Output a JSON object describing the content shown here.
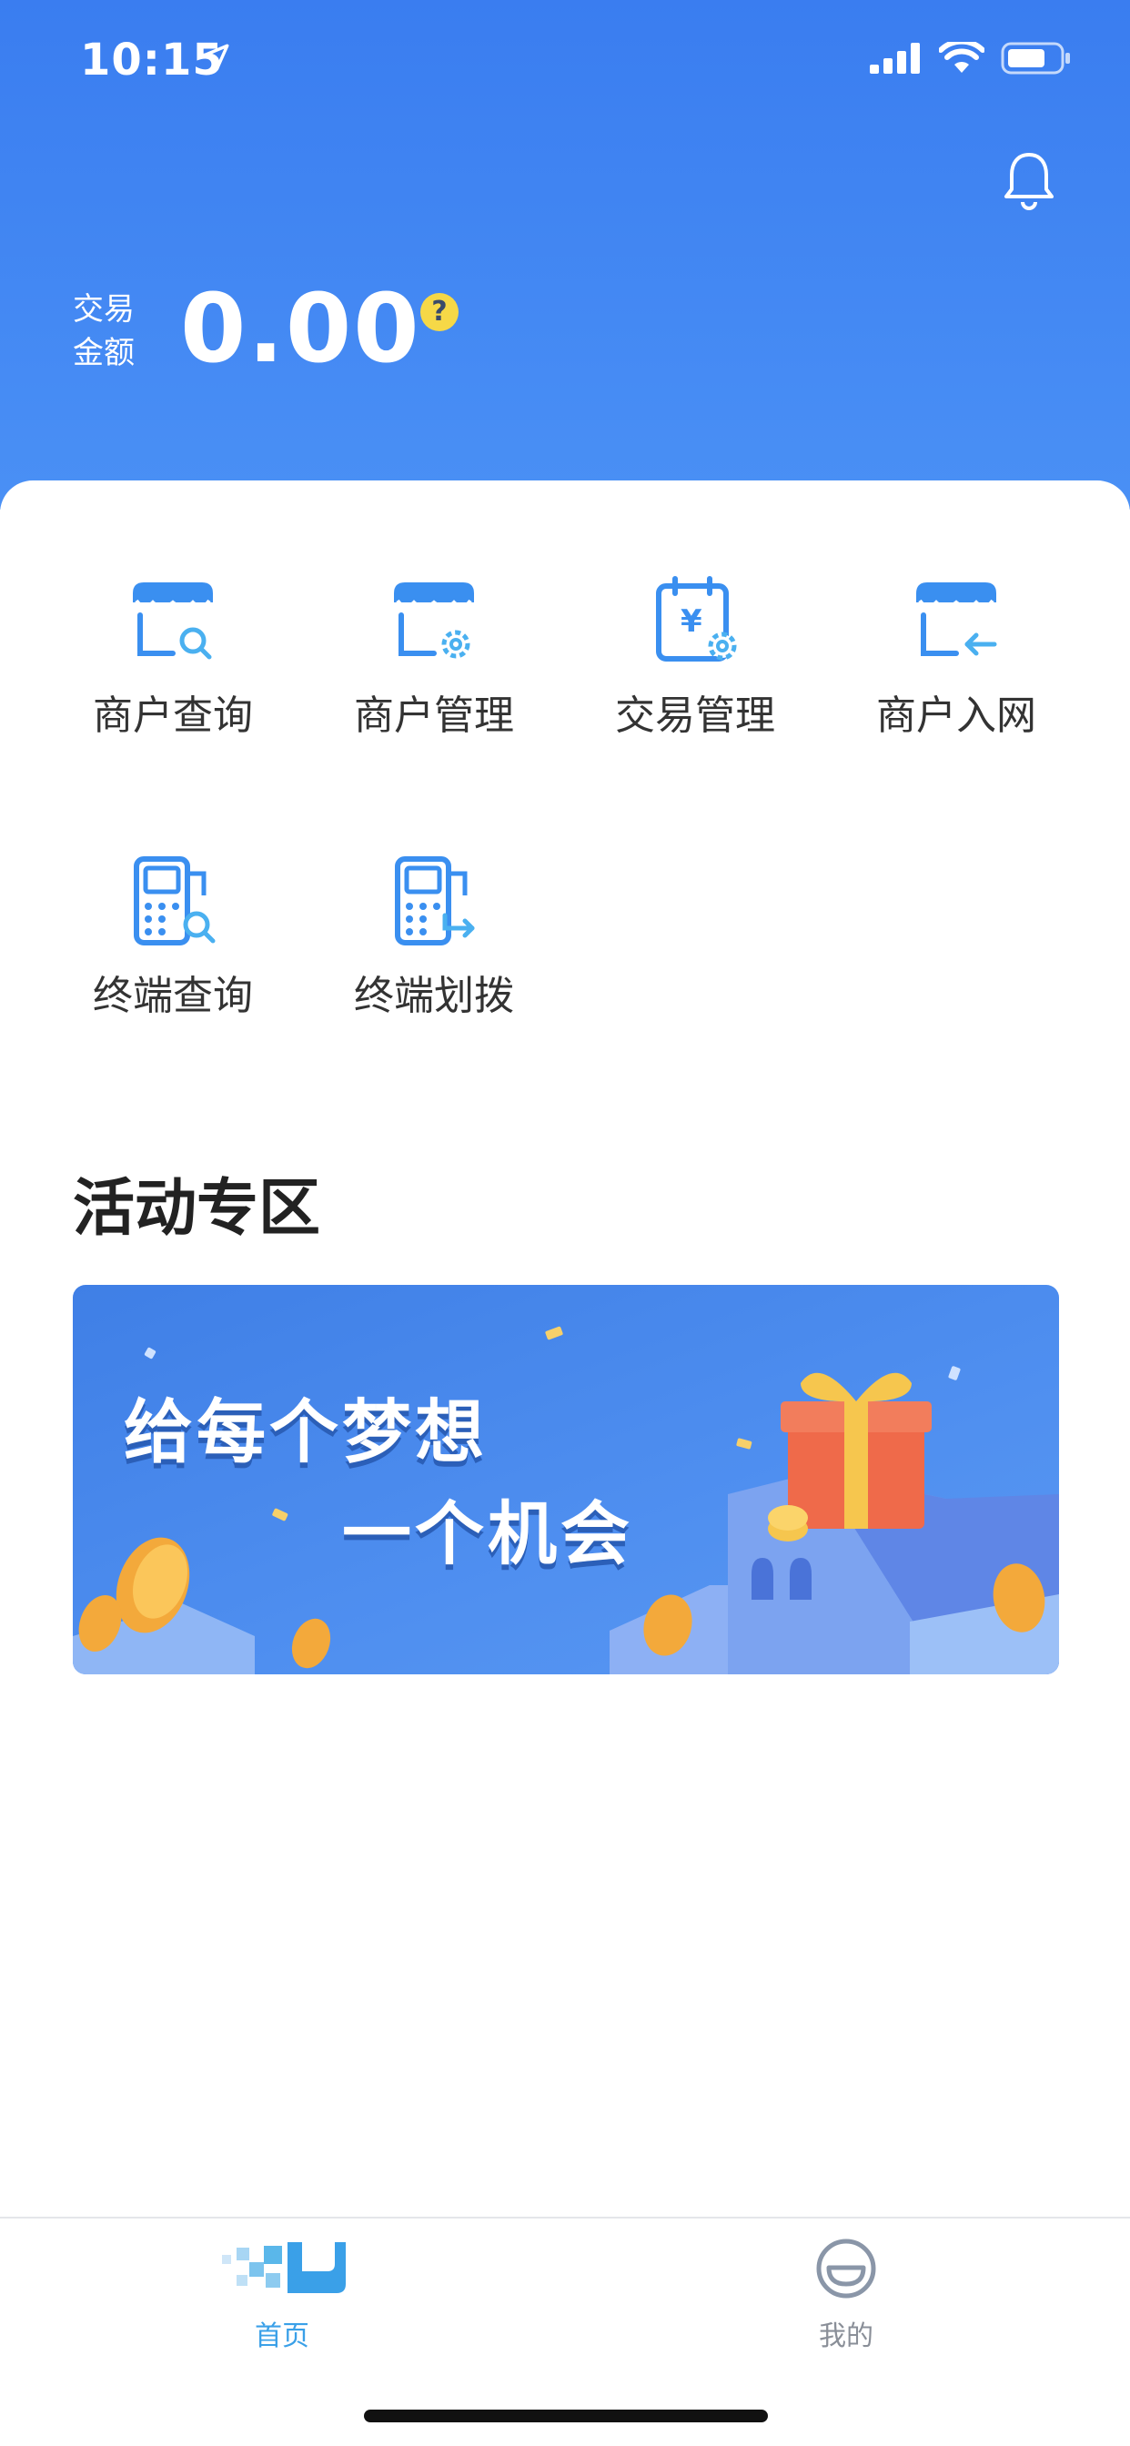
{
  "status_bar": {
    "time": "10:15"
  },
  "header": {
    "amount_label_line1": "交易",
    "amount_label_line2": "金额",
    "amount_value": "0.00",
    "help_icon_text": "?"
  },
  "grid": [
    {
      "label": "商户查询",
      "icon": "merchant-search-icon"
    },
    {
      "label": "商户管理",
      "icon": "merchant-settings-icon"
    },
    {
      "label": "交易管理",
      "icon": "transaction-settings-icon"
    },
    {
      "label": "商户入网",
      "icon": "merchant-join-icon"
    },
    {
      "label": "终端查询",
      "icon": "terminal-search-icon"
    },
    {
      "label": "终端划拨",
      "icon": "terminal-transfer-icon"
    }
  ],
  "section": {
    "title": "活动专区"
  },
  "banner": {
    "line1": "给每个梦想",
    "line2": "一个机会"
  },
  "tabbar": {
    "tabs": [
      {
        "label": "首页",
        "active": true
      },
      {
        "label": "我的",
        "active": false
      }
    ]
  },
  "colors": {
    "primary": "#3a7df0",
    "icon_blue": "#3a8ff0",
    "help_yellow": "#f6d847"
  }
}
